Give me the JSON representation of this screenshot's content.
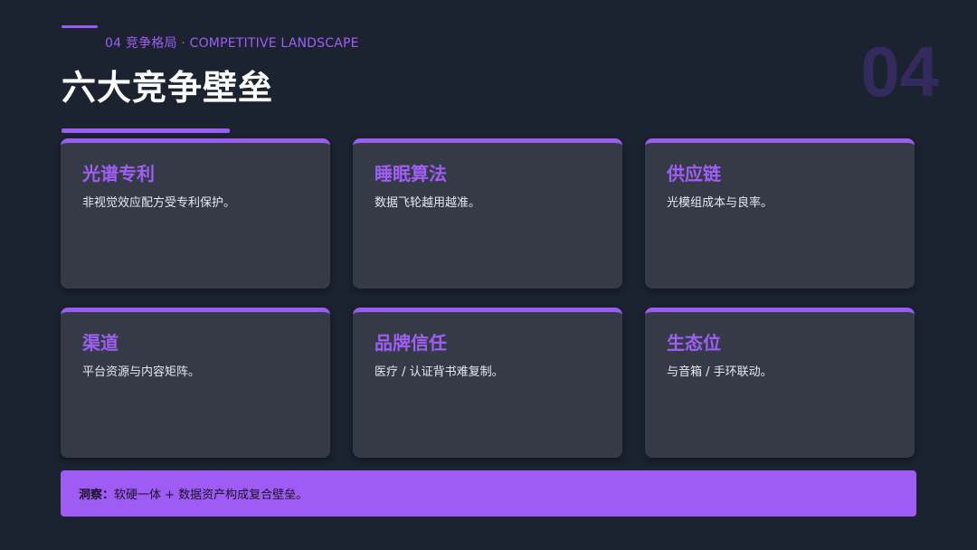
{
  "header": {
    "eyebrow": "04  竞争格局 · COMPETITIVE LANDSCAPE",
    "title": "六大竞争壁垒",
    "watermark": "04"
  },
  "cards": [
    {
      "title": "光谱专利",
      "desc": "非视觉效应配方受专利保护。"
    },
    {
      "title": "睡眠算法",
      "desc": "数据飞轮越用越准。"
    },
    {
      "title": "供应链",
      "desc": "光模组成本与良率。"
    },
    {
      "title": "渠道",
      "desc": "平台资源与内容矩阵。"
    },
    {
      "title": "品牌信任",
      "desc": "医疗 / 认证背书难复制。"
    },
    {
      "title": "生态位",
      "desc": "与音箱 / 手环联动。"
    }
  ],
  "insight": {
    "label": "洞察：",
    "text": "软硬一体 + 数据资产构成复合壁垒。"
  },
  "colors": {
    "background": "#1b2230",
    "accent": "#9b5cf0",
    "card": "#343b46",
    "watermark": "#352a5e"
  }
}
